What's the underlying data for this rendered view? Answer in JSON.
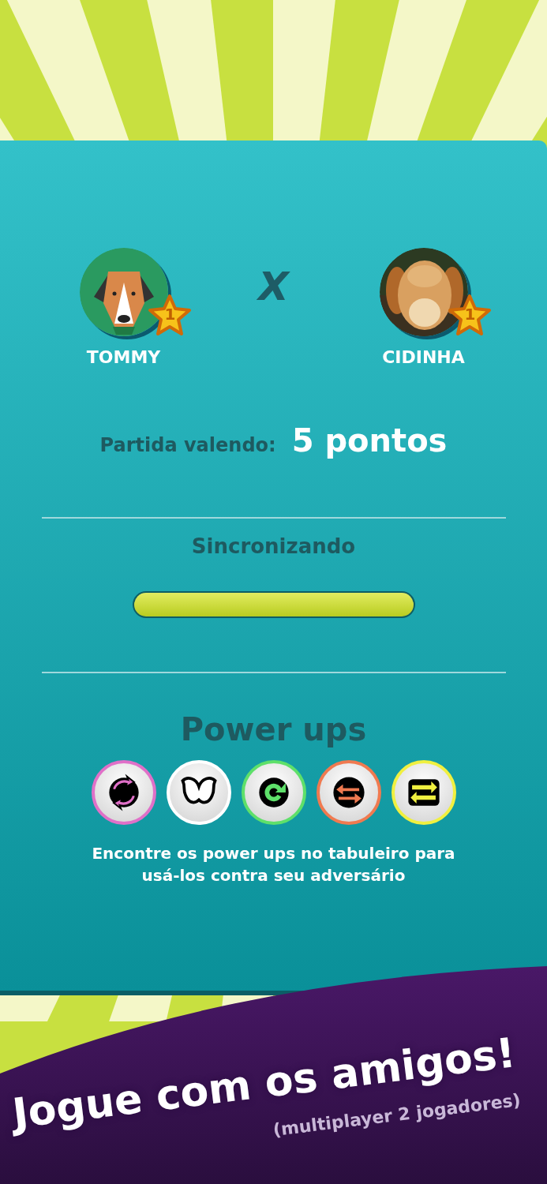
{
  "players": [
    {
      "name": "TOMMY",
      "kind": "illustration",
      "rank": "1"
    },
    {
      "name": "CIDINHA",
      "kind": "picture",
      "rank": "1"
    }
  ],
  "versus": "X",
  "match": {
    "label": "Partida valendo:",
    "value": "5 pontos"
  },
  "sync": {
    "label": "Sincronizando",
    "level": 1
  },
  "power_ups": {
    "title": "Power ups",
    "items": [
      {
        "color": "#e070c8"
      },
      {
        "color": "#ffffff"
      },
      {
        "color": "#5ee06a"
      },
      {
        "color": "#f07a50"
      },
      {
        "color": "#f0f040"
      }
    ],
    "hint": "Encontre os power ups no tabuleiro para usá-los contra seu adversário"
  },
  "banner": {
    "title": "Jogue com os amigos!",
    "subtitle": "(multiplayer 2 jogadores)"
  }
}
